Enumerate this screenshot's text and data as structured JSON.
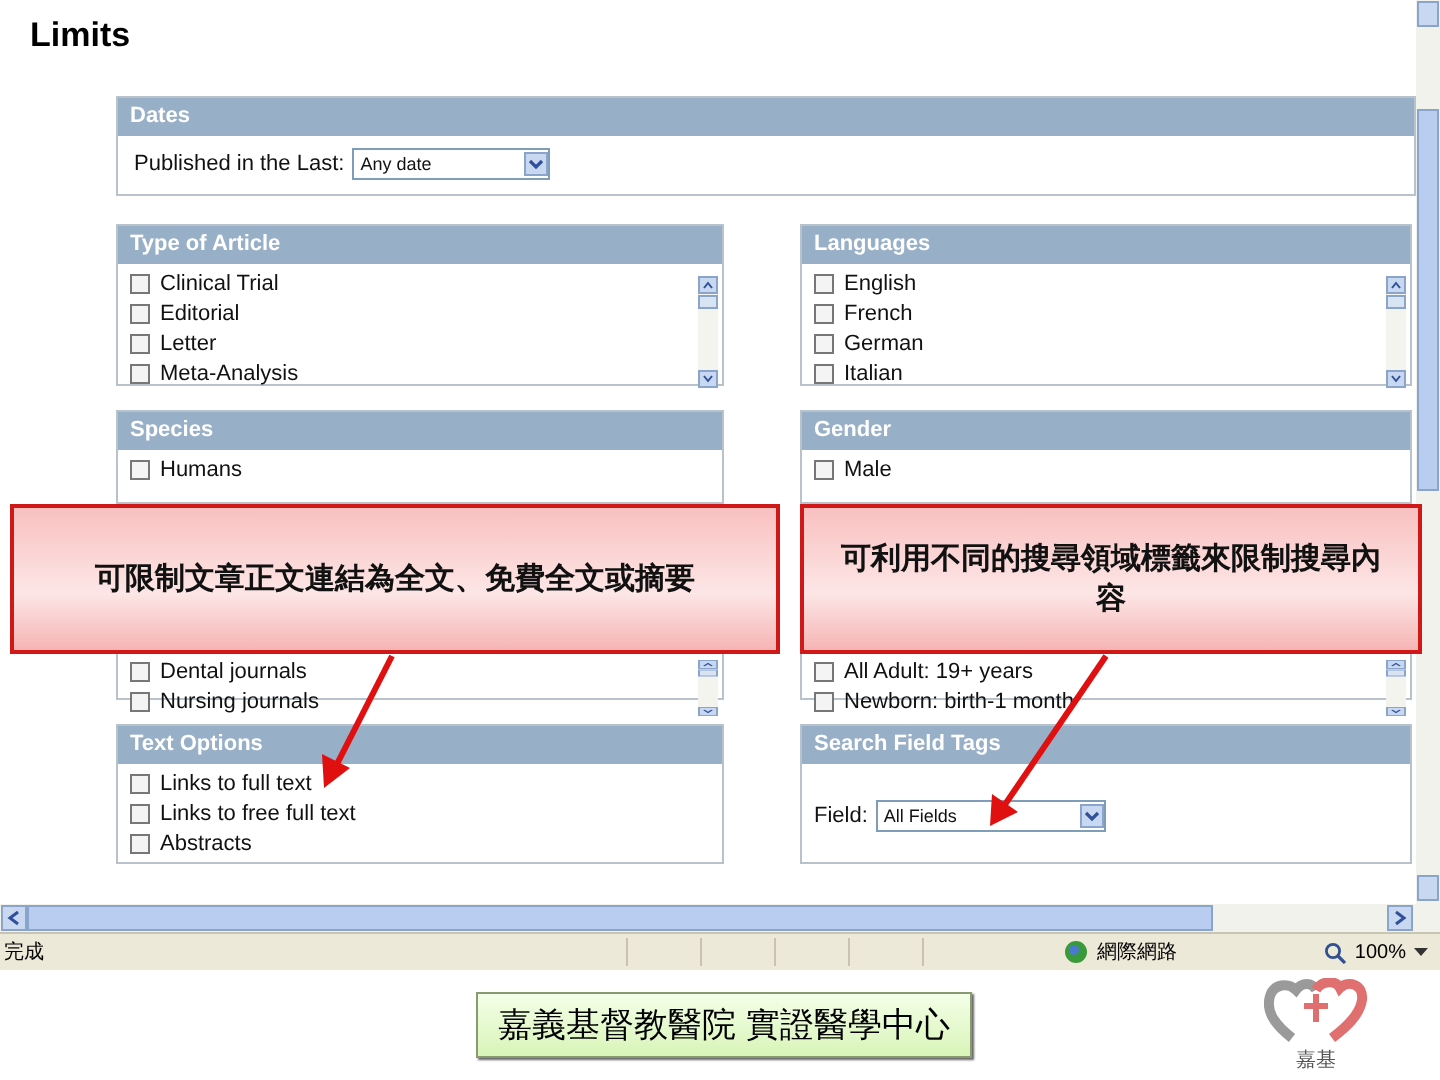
{
  "page_title": "Limits",
  "dates": {
    "title": "Dates",
    "label": "Published in the Last:",
    "value": "Any date"
  },
  "panels": [
    {
      "kind": "scroll-list",
      "title": "Type of Article",
      "items": [
        {
          "label": "Clinical Trial",
          "checked": false
        },
        {
          "label": "Editorial",
          "checked": false
        },
        {
          "label": "Letter",
          "checked": false
        },
        {
          "label": "Meta-Analysis",
          "checked": false
        }
      ]
    },
    {
      "kind": "scroll-list",
      "title": "Languages",
      "items": [
        {
          "label": "English",
          "checked": false
        },
        {
          "label": "French",
          "checked": false
        },
        {
          "label": "German",
          "checked": false
        },
        {
          "label": "Italian",
          "checked": false
        }
      ]
    },
    {
      "kind": "list",
      "title": "Species",
      "items": [
        {
          "label": "Humans",
          "checked": false
        }
      ]
    },
    {
      "kind": "list",
      "title": "Gender",
      "items": [
        {
          "label": "Male",
          "checked": false
        }
      ]
    },
    {
      "kind": "covered-list",
      "items": [
        {
          "label": "Dental journals",
          "checked": false
        },
        {
          "label": "Nursing journals",
          "checked": false
        }
      ]
    },
    {
      "kind": "covered-list",
      "items": [
        {
          "label": "All Adult: 19+ years",
          "checked": false
        },
        {
          "label": "Newborn: birth-1 month",
          "checked": false
        }
      ]
    },
    {
      "kind": "list",
      "title": "Text Options",
      "items": [
        {
          "label": "Links to full text",
          "checked": false
        },
        {
          "label": "Links to free full text",
          "checked": false
        },
        {
          "label": "Abstracts",
          "checked": false
        }
      ]
    },
    {
      "kind": "select",
      "title": "Search Field Tags",
      "label": "Field:",
      "value": "All Fields"
    }
  ],
  "callouts": [
    {
      "text": "可限制文章正文連結為全文、免費全文或摘要"
    },
    {
      "text": "可利用不同的搜尋領域標籤來限制搜尋內容"
    }
  ],
  "status_bar": {
    "status": "完成",
    "zone": "網際網路",
    "zoom": "100%"
  },
  "footer": {
    "label": "嘉義基督教醫院 實證醫學中心",
    "logo_text": "嘉基"
  }
}
